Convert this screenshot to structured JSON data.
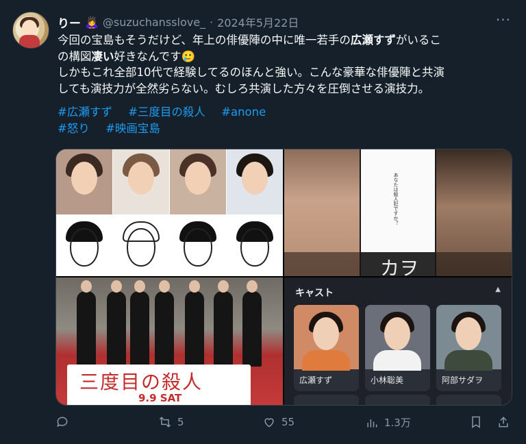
{
  "tweet": {
    "display_name": "りー",
    "badge_emoji": "🙇‍♀️",
    "handle": "@suzuchansslove_",
    "dot": "·",
    "date": "2024年5月22日",
    "more_label": "···",
    "text_line1_a": "今回の宝島もそうだけど、年上の俳優陣の中に唯一若手の",
    "text_line1_bold": "広瀬すず",
    "text_line1_b": "がいるこ",
    "text_line2_a": "の構図",
    "text_line2_bold": "凄い",
    "text_line2_b": "好きなんです",
    "text_line2_emoji": "🥲",
    "text_line3": "しかもこれ全部10代で経験してるのほんと強い。こんな豪華な俳優陣と共演",
    "text_line4": "しても演技力が全然劣らない。むしろ共演した方々を圧倒させる演技力。",
    "hashtags": [
      "#広瀬すず",
      "#三度目の殺人",
      "#anone",
      "#怒り",
      "#映画宝島"
    ]
  },
  "media": {
    "poster_vertical_text": "あなたは殺人犯ですか？",
    "poster_caption": "カヲ",
    "event_banner_title": "三度目の殺人",
    "event_banner_date": "9.9 SAT",
    "cast_panel": {
      "title": "キャスト",
      "caret": "▲",
      "cards": [
        {
          "name": "広瀬すず",
          "bg": "#d08a66"
        },
        {
          "name": "小林聡美",
          "bg": "#6b6f7a"
        },
        {
          "name": "阿部サダヲ",
          "bg": "#7b8a93"
        }
      ]
    }
  },
  "actions": {
    "reply_count": "",
    "retweet_count": "5",
    "like_count": "55",
    "views_count": "1.3万"
  },
  "colors": {
    "background": "#15202b",
    "accent": "#1d9bf0",
    "muted": "#8b98a5",
    "text": "#f7f9f9"
  }
}
